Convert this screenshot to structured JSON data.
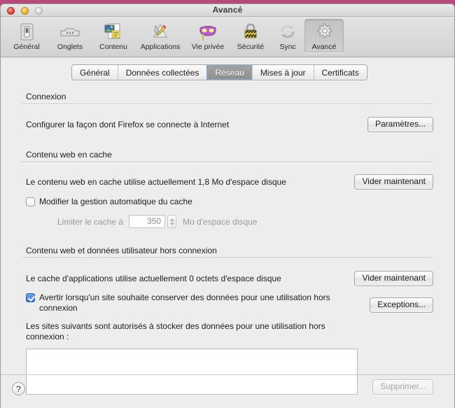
{
  "window": {
    "title": "Avancé",
    "traffic_lights": [
      "close-button",
      "minimize-button",
      "zoom-button"
    ]
  },
  "toolbar": {
    "items": [
      {
        "label": "Général",
        "icon": "light-switch-icon",
        "selected": false
      },
      {
        "label": "Onglets",
        "icon": "tabs-icon",
        "selected": false
      },
      {
        "label": "Contenu",
        "icon": "content-page-icon",
        "selected": false
      },
      {
        "label": "Applications",
        "icon": "applications-icon",
        "selected": false
      },
      {
        "label": "Vie privée",
        "icon": "mask-icon",
        "selected": false
      },
      {
        "label": "Sécurité",
        "icon": "padlock-icon",
        "selected": false
      },
      {
        "label": "Sync",
        "icon": "sync-arrows-icon",
        "selected": false
      },
      {
        "label": "Avancé",
        "icon": "gear-icon",
        "selected": true
      }
    ]
  },
  "tabs": [
    {
      "label": "Général",
      "active": false
    },
    {
      "label": "Données collectées",
      "active": false
    },
    {
      "label": "Réseau",
      "active": true
    },
    {
      "label": "Mises à jour",
      "active": false
    },
    {
      "label": "Certificats",
      "active": false
    }
  ],
  "connection": {
    "heading": "Connexion",
    "description": "Configurer la façon dont Firefox se connecte à Internet",
    "settings_button": "Paramètres..."
  },
  "cache": {
    "heading": "Contenu web en cache",
    "usage_text": "Le contenu web en cache utilise actuellement 1,8 Mo d'espace disque",
    "clear_button": "Vider maintenant",
    "override_checkbox_label": "Modifier la gestion automatique du cache",
    "override_checked": false,
    "limit_prefix": "Limiter le cache à",
    "limit_value": "350",
    "limit_suffix": "Mo d'espace disque"
  },
  "offline": {
    "heading": "Contenu web et données utilisateur hors connexion",
    "usage_text": "Le cache d'applications utilise actuellement 0 octets d'espace disque",
    "clear_button": "Vider maintenant",
    "notify_checkbox_label": "Avertir lorsqu'un site souhaite conserver des données pour une utilisation hors connexion",
    "notify_checked": true,
    "exceptions_button": "Exceptions...",
    "sites_label": "Les sites suivants sont autorisés à stocker des données pour une utilisation hors connexion :",
    "sites": [],
    "remove_button": "Supprimer...",
    "remove_disabled": true
  },
  "footer": {
    "help_label": "?"
  },
  "colors": {
    "accent_blue": "#3a79cc",
    "selected_tab": "#8f8f8f",
    "window_bg": "#ededed",
    "desktop": "#b94a7c"
  }
}
